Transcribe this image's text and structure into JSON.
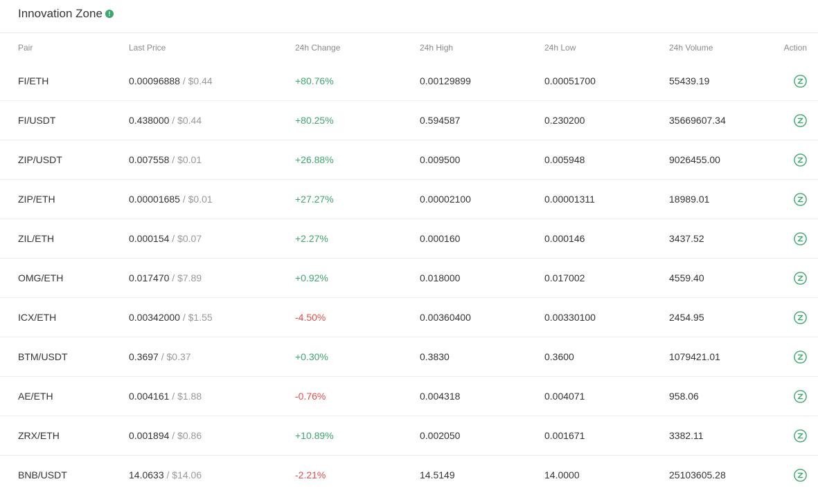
{
  "header": {
    "title": "Innovation Zone",
    "info_icon": "!"
  },
  "columns": {
    "pair": "Pair",
    "last_price": "Last Price",
    "change": "24h Change",
    "high": "24h High",
    "low": "24h Low",
    "volume": "24h Volume",
    "action": "Action"
  },
  "colors": {
    "up": "#3aa76d",
    "down": "#e84b4b",
    "usd": "#999999"
  },
  "rows": [
    {
      "pair": "FI/ETH",
      "price": "0.00096888",
      "usd": " / $0.44",
      "change": "+80.76%",
      "direction": "up",
      "high": "0.00129899",
      "low": "0.00051700",
      "volume": "55439.19",
      "action_icon": "trade-icon"
    },
    {
      "pair": "FI/USDT",
      "price": "0.438000",
      "usd": " / $0.44",
      "change": "+80.25%",
      "direction": "up",
      "high": "0.594587",
      "low": "0.230200",
      "volume": "35669607.34",
      "action_icon": "trade-icon"
    },
    {
      "pair": "ZIP/USDT",
      "price": "0.007558",
      "usd": " / $0.01",
      "change": "+26.88%",
      "direction": "up",
      "high": "0.009500",
      "low": "0.005948",
      "volume": "9026455.00",
      "action_icon": "trade-icon"
    },
    {
      "pair": "ZIP/ETH",
      "price": "0.00001685",
      "usd": " / $0.01",
      "change": "+27.27%",
      "direction": "up",
      "high": "0.00002100",
      "low": "0.00001311",
      "volume": "18989.01",
      "action_icon": "trade-icon"
    },
    {
      "pair": "ZIL/ETH",
      "price": "0.000154",
      "usd": " / $0.07",
      "change": "+2.27%",
      "direction": "up",
      "high": "0.000160",
      "low": "0.000146",
      "volume": "3437.52",
      "action_icon": "trade-icon"
    },
    {
      "pair": "OMG/ETH",
      "price": "0.017470",
      "usd": " / $7.89",
      "change": "+0.92%",
      "direction": "up",
      "high": "0.018000",
      "low": "0.017002",
      "volume": "4559.40",
      "action_icon": "trade-icon"
    },
    {
      "pair": "ICX/ETH",
      "price": "0.00342000",
      "usd": " / $1.55",
      "change": "-4.50%",
      "direction": "down",
      "high": "0.00360400",
      "low": "0.00330100",
      "volume": "2454.95",
      "action_icon": "trade-icon"
    },
    {
      "pair": "BTM/USDT",
      "price": "0.3697",
      "usd": " / $0.37",
      "change": "+0.30%",
      "direction": "up",
      "high": "0.3830",
      "low": "0.3600",
      "volume": "1079421.01",
      "action_icon": "trade-icon"
    },
    {
      "pair": "AE/ETH",
      "price": "0.004161",
      "usd": " / $1.88",
      "change": "-0.76%",
      "direction": "down",
      "high": "0.004318",
      "low": "0.004071",
      "volume": "958.06",
      "action_icon": "trade-icon"
    },
    {
      "pair": "ZRX/ETH",
      "price": "0.001894",
      "usd": " / $0.86",
      "change": "+10.89%",
      "direction": "up",
      "high": "0.002050",
      "low": "0.001671",
      "volume": "3382.11",
      "action_icon": "trade-icon"
    },
    {
      "pair": "BNB/USDT",
      "price": "14.0633",
      "usd": " / $14.06",
      "change": "-2.21%",
      "direction": "down",
      "high": "14.5149",
      "low": "14.0000",
      "volume": "25103605.28",
      "action_icon": "trade-icon"
    }
  ]
}
